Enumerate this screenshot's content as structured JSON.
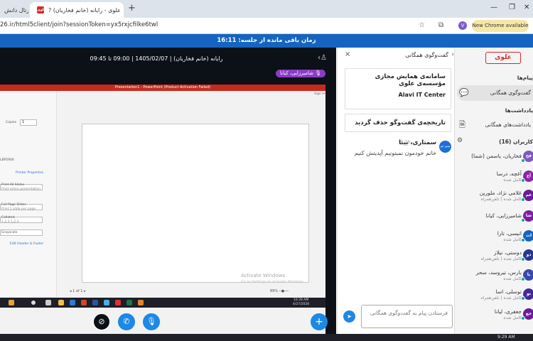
{
  "browser": {
    "tabs": [
      {
        "label": "پرتال دانش"
      },
      {
        "label": "علوی - رایانه (خانم فخاریان) ?"
      }
    ],
    "url": "26.ir/html5client/join?sessionToken=yx5rxjcfilke6twl",
    "new_chrome_label": "New Chrome available",
    "profile_initial": "V"
  },
  "timer": {
    "label": "زمان باقی مانده از جلسه: 16:11"
  },
  "session": {
    "title": "رایانه (خانم فخاریان) | 1405/02/07 | 09:00 تا 09:45",
    "presenter": "شامیرزایی، کیانا"
  },
  "screenshare": {
    "app_title": "Presentation1 - PowerPoint (Product Activation Failed)",
    "copies_label": "Copies",
    "copies_value": "1",
    "printer_properties": "Printer Properties",
    "printer_name": "LBP2900",
    "print_all_slides": "Print All Slides",
    "print_all_slides_desc": "Print entire presentation",
    "full_page": "Full Page Slides",
    "full_page_desc": "Print 1 slide per page",
    "collated": "Collated",
    "collated_desc": "1,2,3   1,2,3",
    "grayscale": "Grayscale",
    "edit_header": "Edit Header & Footer",
    "activate": "Activate Windows",
    "activate_desc": "Go to Settings to activate Windows.",
    "sign_in": "Sign in",
    "page_current": "1",
    "page_total": "of 1",
    "zoom": "89%",
    "clock_time": "10:39 AM",
    "clock_date": "4/27/2026"
  },
  "chat": {
    "header": "گفت‌وگوی همگانی",
    "welcome_line1": "سامانه‌ی همایش مجازی",
    "welcome_line2": "مؤسسه‌ی علوی",
    "welcome_line3": "Alavi IT Center",
    "cleared": "تاریخچه‌ی گفت‌وگو حذف گردید",
    "message": {
      "avatar": "سم ثم",
      "author": "سمتاری، بینا",
      "time": "9:28",
      "text": "خانم خودمون نمیتونیم آپدیتش کنیم"
    },
    "input_placeholder": "فرستادن پیام به گفت‌وگوی همگانی"
  },
  "users_panel": {
    "logo": "علوی",
    "messages_title": "پیام‌ها",
    "public_chat": "گفت‌وگوی همگانی",
    "notes_title": "یادداشت‌ها",
    "shared_notes": "یادداشت‌های همگانی",
    "users_title": "کاربران (16)",
    "users": [
      {
        "initials": "فخ",
        "name": "فخاریان، یاسمن (شما)",
        "status": "",
        "color": "#7e57c2"
      },
      {
        "initials": "آع",
        "name": "آغچه، درسا",
        "status": "کامل شده",
        "color": "#8e24aa"
      },
      {
        "initials": "غم",
        "name": "غلامی نژاد، ملورین",
        "status": "کامل شده | تلفن‌همراه",
        "color": "#6a1b9a"
      },
      {
        "initials": "شا",
        "name": "شامیرزایی، کیانا",
        "status": "",
        "color": "#7b1fa2"
      },
      {
        "initials": "اث",
        "name": "انیسی، تارا",
        "status": "کامل شده",
        "color": "#1565c0"
      },
      {
        "initials": "دو",
        "name": "دوستی، نیلاز",
        "status": "کامل شده | تلفن‌همراه",
        "color": "#283593"
      },
      {
        "initials": "با",
        "name": "بارس، تیروسد، سحر",
        "status": "کامل شده",
        "color": "#3949ab"
      },
      {
        "initials": "تو",
        "name": "توسلی، اسا",
        "status": "کامل شده | تلفن‌همراه",
        "color": "#4527a0"
      },
      {
        "initials": "جع",
        "name": "جعفری، لیانا",
        "status": "کامل شده",
        "color": "#6a1b9a"
      }
    ]
  },
  "os_taskbar": {
    "time": "9:29 AM"
  }
}
